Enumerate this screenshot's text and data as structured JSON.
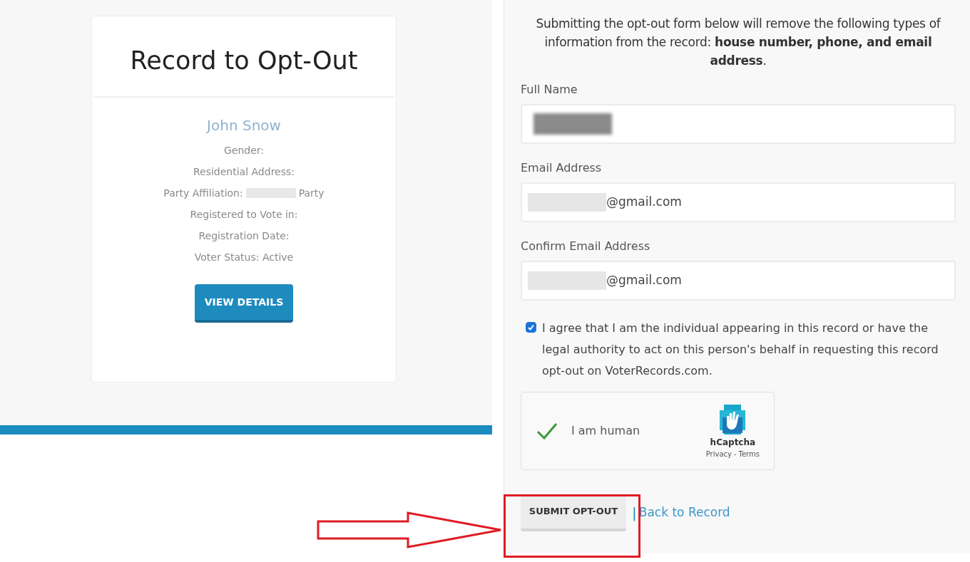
{
  "record_card": {
    "title": "Record to Opt-Out",
    "name": "John Snow",
    "lines": [
      {
        "label": "Gender:"
      },
      {
        "label": "Residential Address:"
      },
      {
        "label": "Party Affiliation:",
        "value": "Party"
      },
      {
        "label": "Registered to Vote in:"
      },
      {
        "label": "Registration Date:"
      },
      {
        "label": "Voter Status: Active"
      }
    ],
    "button": "VIEW DETAILS"
  },
  "form": {
    "intro": "Submitting the opt-out form below will remove the following types of information from the record: **house number, phone, and email address**.",
    "fields": [
      {
        "label": "Full Name"
      },
      {
        "label": "Email Address",
        "value": "@gmail.com"
      },
      {
        "label": "Confirm Email Address",
        "value": "@gmail.com"
      }
    ],
    "agreement": {
      "checked": true,
      "text": "I agree that I am the individual appearing in this record or have the legal authority to act on this person's behalf in requesting this record opt-out on VoterRecords.com."
    },
    "captcha": {
      "checked": true,
      "label": "I am human",
      "brand": "hCaptcha",
      "links": [
        "Privacy",
        "Terms"
      ],
      "link_separator": "-"
    },
    "submit": "SUBMIT OPT-OUT",
    "separator": "|",
    "back_link": "Back to Record"
  }
}
